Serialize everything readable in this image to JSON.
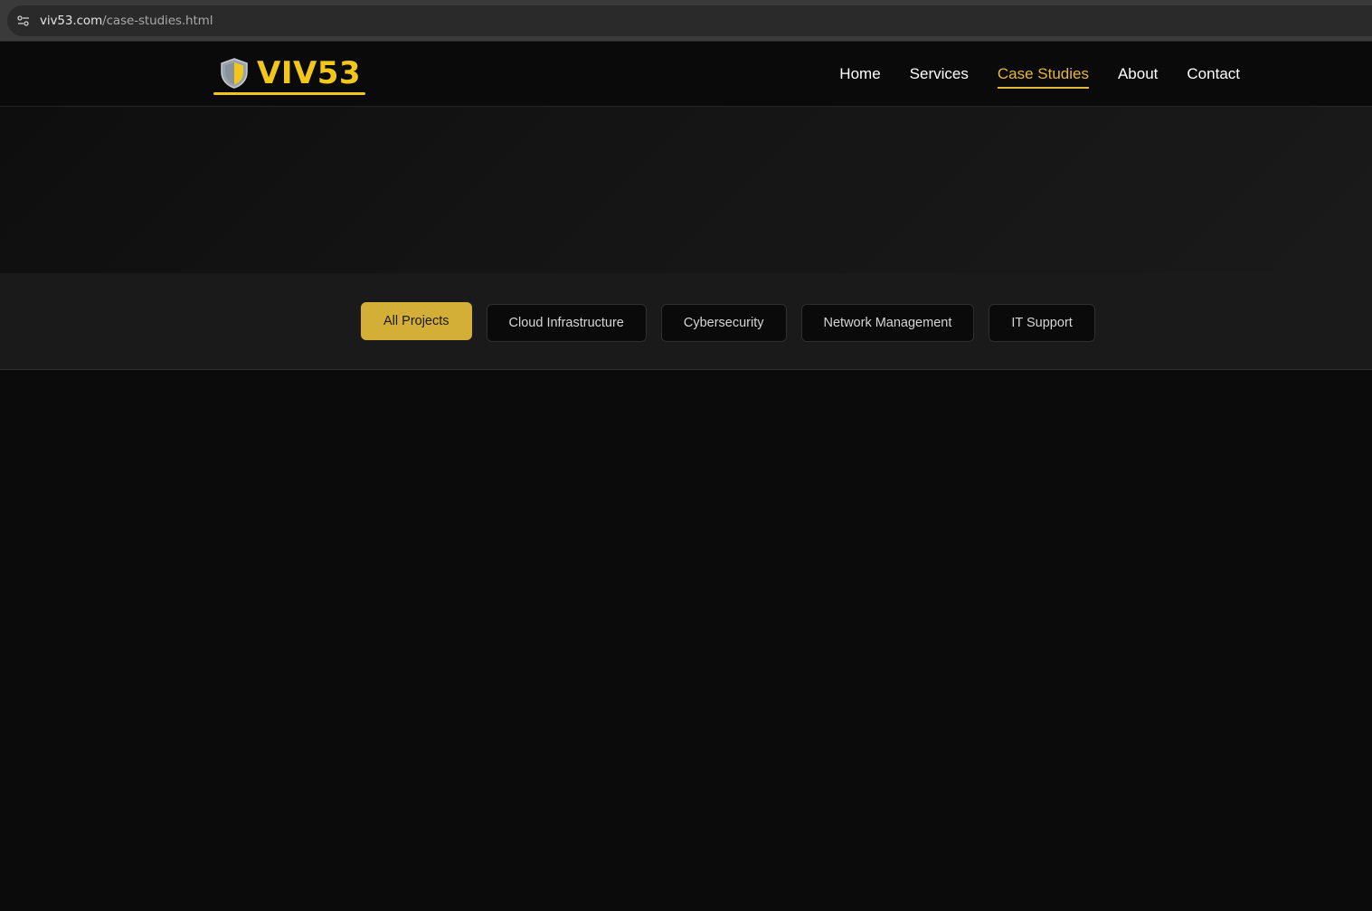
{
  "browser": {
    "url_domain": "viv53.com",
    "url_path": "/case-studies.html",
    "site_info_icon": "tune-icon"
  },
  "header": {
    "logo_text": "VIV53",
    "logo_icon": "shield-icon",
    "nav": [
      {
        "label": "Home",
        "active": false
      },
      {
        "label": "Services",
        "active": false
      },
      {
        "label": "Case Studies",
        "active": true
      },
      {
        "label": "About",
        "active": false
      },
      {
        "label": "Contact",
        "active": false
      }
    ]
  },
  "filters": {
    "items": [
      {
        "label": "All Projects",
        "active": true
      },
      {
        "label": "Cloud Infrastructure",
        "active": false
      },
      {
        "label": "Cybersecurity",
        "active": false
      },
      {
        "label": "Network Management",
        "active": false
      },
      {
        "label": "IT Support",
        "active": false
      }
    ]
  },
  "colors": {
    "accent": "#d4af37",
    "logo": "#f2c71b",
    "background": "#0b0b0b"
  }
}
